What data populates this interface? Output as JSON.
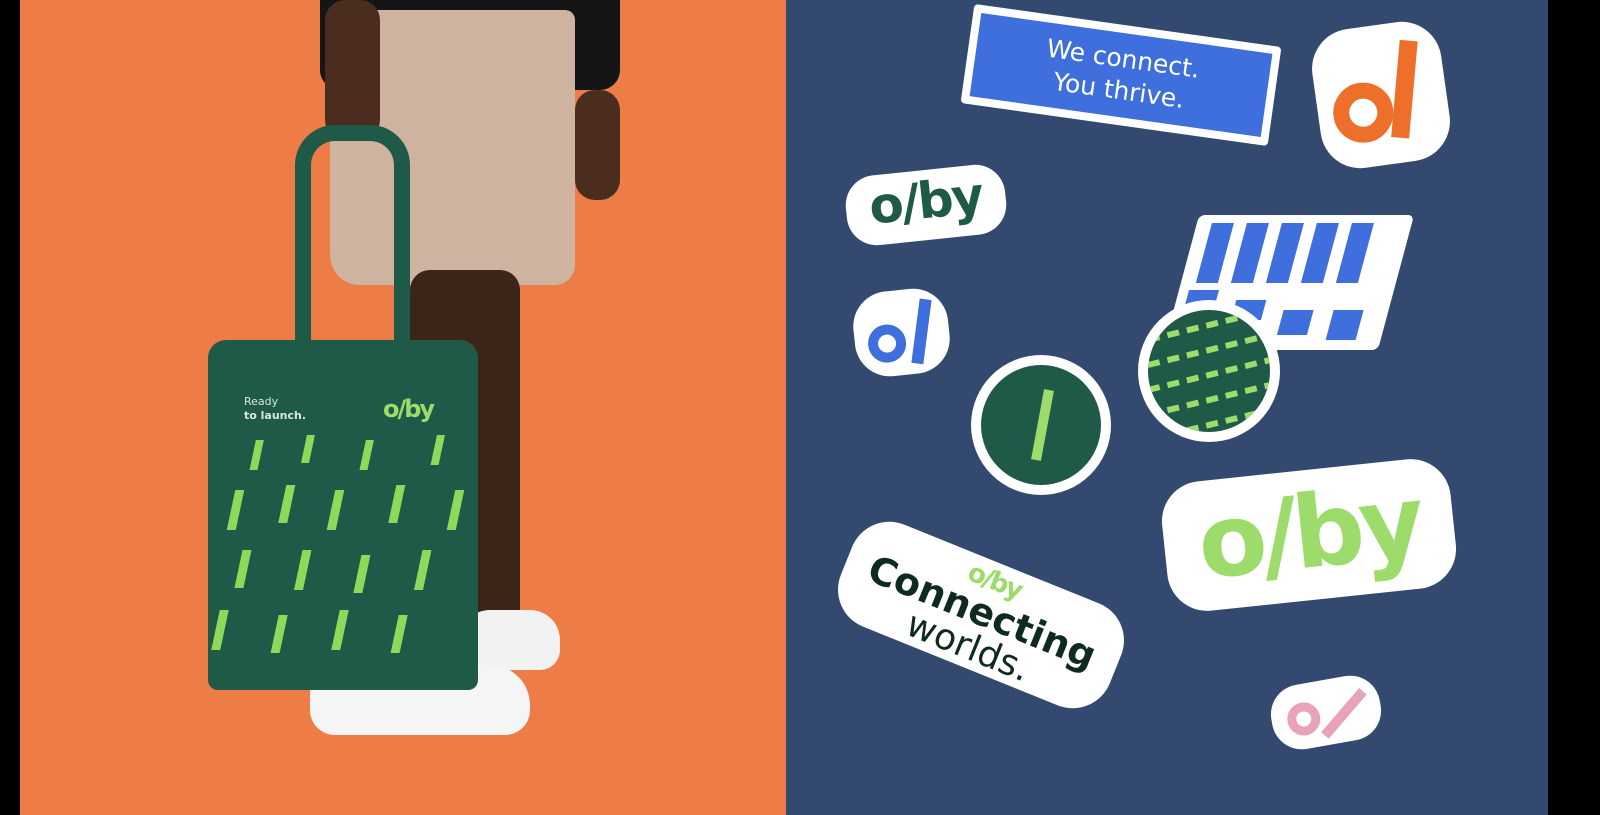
{
  "bag": {
    "tagline_line1": "Ready",
    "tagline_line2": "to launch.",
    "logo": "o/by"
  },
  "stickers": {
    "slogan_line1": "We connect.",
    "slogan_line2": "You thrive.",
    "logo_small": "o/by",
    "logo_large": "o/by",
    "logo_connect": "o/by",
    "connect_line1": "Connecting",
    "connect_line2": "worlds.",
    "monogram": "o/"
  },
  "colors": {
    "orange": "#ee7c47",
    "navy": "#34496f",
    "green": "#1f5a48",
    "lime": "#9ddb6a",
    "blue": "#3f6fdc",
    "pink": "#e8a3b8"
  }
}
